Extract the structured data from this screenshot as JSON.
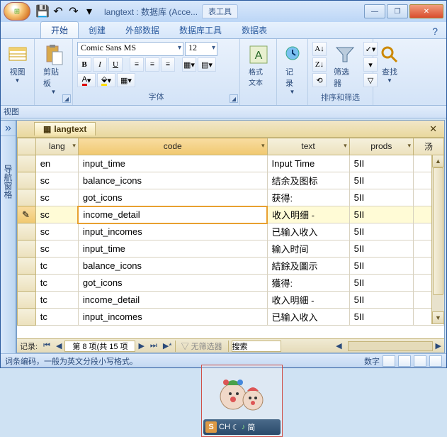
{
  "title": "langtext : 数据库 (Acce...",
  "tools_tab": "表工具",
  "win": {
    "min": "—",
    "max": "❐",
    "close": "✕"
  },
  "qat": {
    "save": "💾",
    "undo": "↶",
    "redo": "↷",
    "more": "▾"
  },
  "ribbon": {
    "tabs": {
      "home": "开始",
      "create": "创建",
      "external": "外部数据",
      "dbtools": "数据库工具",
      "datasheet": "数据表"
    },
    "help": "?",
    "view": "视图",
    "clipboard": "剪贴板",
    "font_group": "字体",
    "font_name": "Comic Sans MS",
    "font_size": "12",
    "format_text": "格式文本",
    "records": "记录",
    "sort_filter_group": "排序和筛选",
    "filter": "筛选器",
    "find": "查找",
    "bold": "B",
    "italic": "I",
    "underline": "U"
  },
  "subheader": "视图",
  "nav": {
    "toggle": "»",
    "label": "导航窗格"
  },
  "object_tab": {
    "name": "langtext",
    "close": "✕"
  },
  "columns": {
    "lang": "lang",
    "code": "code",
    "text": "text",
    "prods": "prods",
    "rest": "汤"
  },
  "rows": [
    {
      "lang": "en",
      "code": "input_time",
      "text": "Input Time",
      "prods": "5II"
    },
    {
      "lang": "sc",
      "code": "balance_icons",
      "text": "结余及图标",
      "prods": "5II"
    },
    {
      "lang": "sc",
      "code": "got_icons",
      "text": "获得:",
      "prods": "5II"
    },
    {
      "lang": "sc",
      "code": "income_detail",
      "text": "收入明细 -",
      "prods": "5II"
    },
    {
      "lang": "sc",
      "code": "input_incomes",
      "text": "已输入收入",
      "prods": "5II"
    },
    {
      "lang": "sc",
      "code": "input_time",
      "text": "输入时间",
      "prods": "5II"
    },
    {
      "lang": "tc",
      "code": "balance_icons",
      "text": "結餘及圖示",
      "prods": "5II"
    },
    {
      "lang": "tc",
      "code": "got_icons",
      "text": "獲得:",
      "prods": "5II"
    },
    {
      "lang": "tc",
      "code": "income_detail",
      "text": "收入明細 -",
      "prods": "5II"
    },
    {
      "lang": "tc",
      "code": "input_incomes",
      "text": "已输入收入",
      "prods": "5II"
    }
  ],
  "selected_row_index": 3,
  "ime": {
    "s": "S",
    "ch": "CH",
    "moon": "☾",
    "jian": "简"
  },
  "recnav": {
    "label": "记录:",
    "first": "⏮",
    "prev": "◀",
    "pos": "第 8 项(共 15 项",
    "next": "▶",
    "last": "⏭",
    "new": "▶*",
    "nofilter": "无筛选器",
    "search_ph": "搜索"
  },
  "status": {
    "left": "词条编码，一般为英文分段小写格式。",
    "right": "数字"
  }
}
